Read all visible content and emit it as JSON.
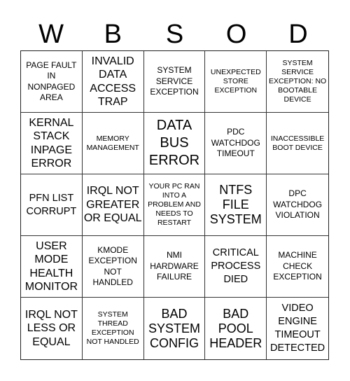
{
  "card": {
    "header": [
      "W",
      "B",
      "S",
      "O",
      "D"
    ],
    "cells": [
      [
        "PAGE FAULT IN NONPAGED AREA",
        "INVALID DATA ACCESS TRAP",
        "SYSTEM SERVICE EXCEPTION",
        "UNEXPECTED STORE EXCEPTION",
        "SYSTEM SERVICE EXCEPTION: NO BOOTABLE DEVICE"
      ],
      [
        "KERNAL STACK INPAGE ERROR",
        "MEMORY MANAGEMENT",
        "DATA BUS ERROR",
        "PDC WATCHDOG TIMEOUT",
        "INACCESSIBLE BOOT DEVICE"
      ],
      [
        "PFN LIST CORRUPT",
        "IRQL NOT GREATER OR EQUAL",
        "YOUR PC RAN INTO A PROBLEM AND NEEDS TO RESTART",
        "NTFS FILE SYSTEM",
        "DPC WATCHDOG VIOLATION"
      ],
      [
        "USER MODE HEALTH MONITOR",
        "KMODE EXCEPTION NOT HANDLED",
        "NMI HARDWARE FAILURE",
        "CRITICAL PROCESS DIED",
        "MACHINE CHECK EXCEPTION"
      ],
      [
        "IRQL NOT LESS OR EQUAL",
        "SYSTEM THREAD EXCEPTION NOT HANDLED",
        "BAD SYSTEM CONFIG",
        "BAD POOL HEADER",
        "VIDEO ENGINE TIMEOUT DETECTED"
      ]
    ]
  }
}
